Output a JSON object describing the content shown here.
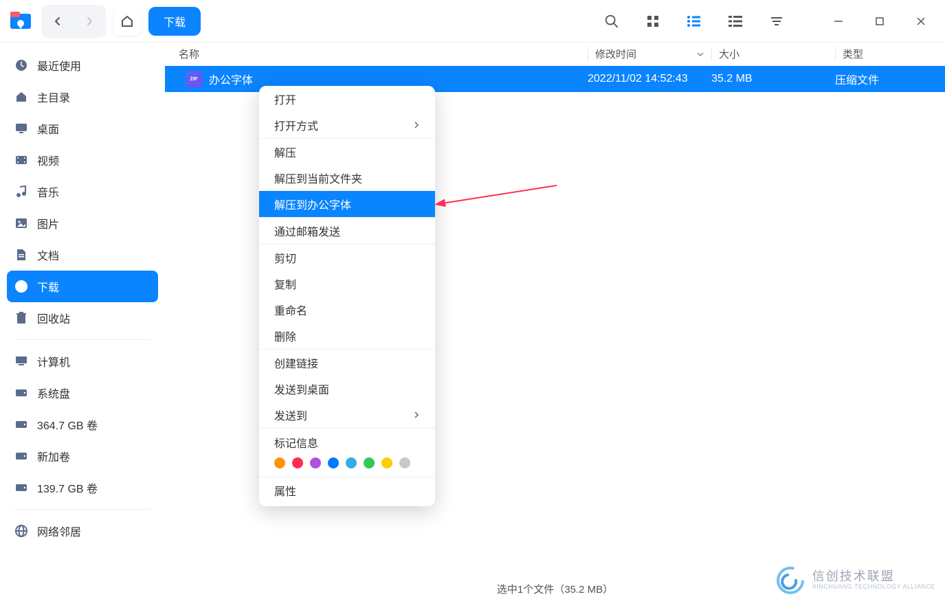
{
  "toolbar": {
    "download_label": "下载"
  },
  "columns": {
    "name": "名称",
    "modified": "修改时间",
    "size": "大小",
    "type": "类型"
  },
  "sidebar": {
    "items": [
      {
        "icon": "clock",
        "label": "最近使用"
      },
      {
        "icon": "home",
        "label": "主目录"
      },
      {
        "icon": "desktop",
        "label": "桌面"
      },
      {
        "icon": "video",
        "label": "视频"
      },
      {
        "icon": "music",
        "label": "音乐"
      },
      {
        "icon": "image",
        "label": "图片"
      },
      {
        "icon": "document",
        "label": "文档"
      },
      {
        "icon": "download",
        "label": "下载",
        "active": true
      },
      {
        "icon": "trash",
        "label": "回收站"
      }
    ],
    "devices": [
      {
        "icon": "computer",
        "label": "计算机"
      },
      {
        "icon": "disk",
        "label": "系统盘"
      },
      {
        "icon": "disk",
        "label": "364.7 GB 卷"
      },
      {
        "icon": "disk",
        "label": "新加卷"
      },
      {
        "icon": "disk",
        "label": "139.7 GB 卷"
      }
    ],
    "network": [
      {
        "icon": "network",
        "label": "网络邻居"
      }
    ]
  },
  "files": [
    {
      "name": "办公字体",
      "modified": "2022/11/02 14:52:43",
      "size": "35.2 MB",
      "type": "压缩文件",
      "selected": true
    }
  ],
  "context_menu": {
    "groups": [
      [
        {
          "label": "打开"
        },
        {
          "label": "打开方式",
          "submenu": true
        }
      ],
      [
        {
          "label": "解压"
        },
        {
          "label": "解压到当前文件夹"
        },
        {
          "label": "解压到办公字体",
          "highlighted": true
        }
      ],
      [
        {
          "label": "通过邮箱发送"
        }
      ],
      [
        {
          "label": "剪切"
        },
        {
          "label": "复制"
        },
        {
          "label": "重命名"
        },
        {
          "label": "删除"
        }
      ],
      [
        {
          "label": "创建链接"
        },
        {
          "label": "发送到桌面"
        },
        {
          "label": "发送到",
          "submenu": true
        }
      ]
    ],
    "tag_label": "标记信息",
    "tag_colors": [
      "#ff9500",
      "#ff2d55",
      "#af52de",
      "#007aff",
      "#32ade6",
      "#34c759",
      "#ffcc00",
      "#c7c7cc"
    ],
    "properties_label": "属性"
  },
  "status": {
    "text": "选中1个文件（35.2 MB）"
  },
  "watermark": {
    "cn": "信创技术联盟",
    "en": "XINCHUANG TECHNOLOGY ALLIANCE"
  }
}
